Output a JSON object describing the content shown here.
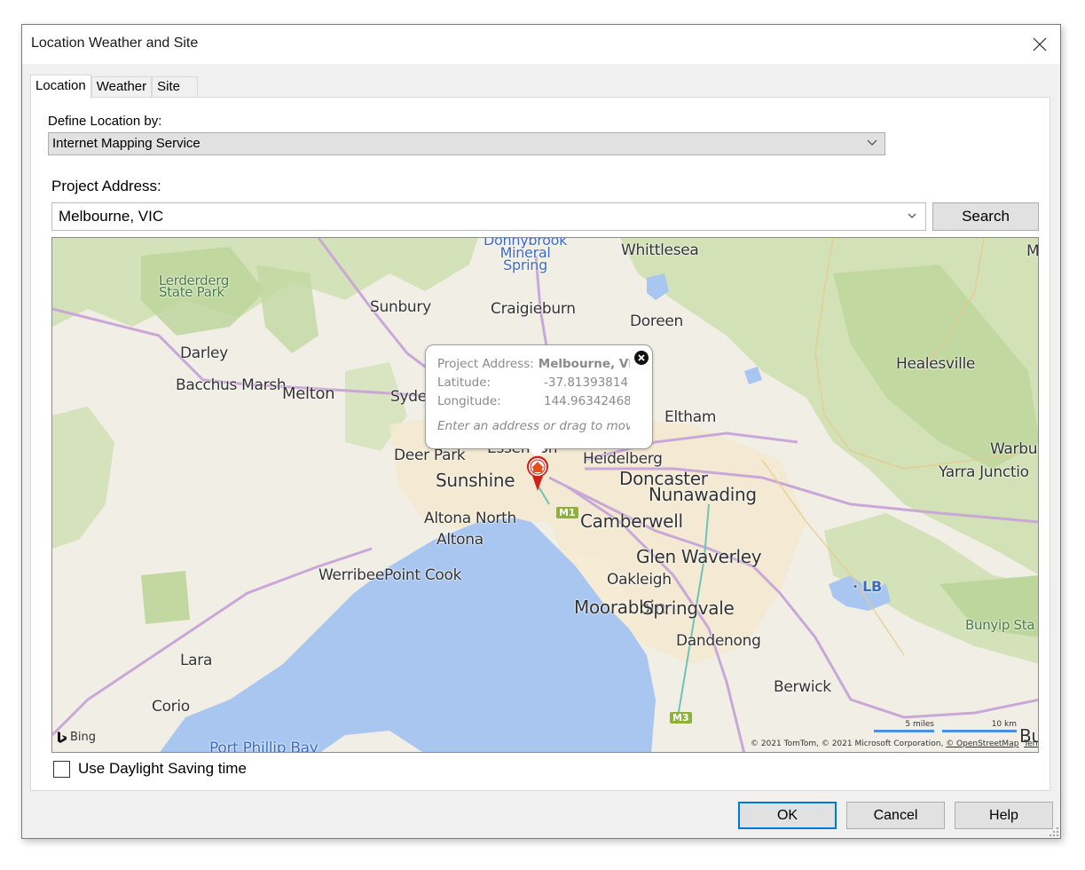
{
  "window": {
    "title": "Location Weather and Site",
    "close_icon": "close-icon"
  },
  "tabs": [
    {
      "label": "Location",
      "active": true
    },
    {
      "label": "Weather",
      "active": false
    },
    {
      "label": "Site",
      "active": false
    }
  ],
  "location": {
    "define_label": "Define Location by:",
    "define_value": "Internet Mapping Service",
    "project_address_label": "Project Address:",
    "project_address_value": "Melbourne, VIC",
    "search_label": "Search"
  },
  "map": {
    "provider": "Bing",
    "places": [
      {
        "name": "Lerderderg\nState Park",
        "type": "park"
      },
      {
        "name": "Donnybrook\nMineral\nSpring",
        "type": "water"
      },
      {
        "name": "Whittlesea",
        "type": "town"
      },
      {
        "name": "Sunbury",
        "type": "town"
      },
      {
        "name": "Craigieburn",
        "type": "town"
      },
      {
        "name": "Doreen",
        "type": "town"
      },
      {
        "name": "Darley",
        "type": "town"
      },
      {
        "name": "Healesville",
        "type": "town"
      },
      {
        "name": "Bacchus Marsh",
        "type": "town"
      },
      {
        "name": "Melton",
        "type": "town"
      },
      {
        "name": "Syde",
        "type": "town"
      },
      {
        "name": "Eltham",
        "type": "town"
      },
      {
        "name": "Deer Park",
        "type": "town"
      },
      {
        "name": "Essendon",
        "type": "town"
      },
      {
        "name": "Heidelberg",
        "type": "town"
      },
      {
        "name": "Warbu",
        "type": "town"
      },
      {
        "name": "Yarra Junctio",
        "type": "town"
      },
      {
        "name": "Sunshine",
        "type": "town"
      },
      {
        "name": "Doncaster",
        "type": "town"
      },
      {
        "name": "Nunawading",
        "type": "town"
      },
      {
        "name": "Altona North",
        "type": "town"
      },
      {
        "name": "Camberwell",
        "type": "town"
      },
      {
        "name": "Altona",
        "type": "town"
      },
      {
        "name": "Glen Waverley",
        "type": "town"
      },
      {
        "name": "Werribee",
        "type": "town"
      },
      {
        "name": "Point Cook",
        "type": "town"
      },
      {
        "name": "Oakleigh",
        "type": "town"
      },
      {
        "name": "LB",
        "type": "water"
      },
      {
        "name": "Moorabbin",
        "type": "town"
      },
      {
        "name": "Springvale",
        "type": "town"
      },
      {
        "name": "Bunyip Sta",
        "type": "park"
      },
      {
        "name": "Dandenong",
        "type": "town"
      },
      {
        "name": "Lara",
        "type": "town"
      },
      {
        "name": "Berwick",
        "type": "town"
      },
      {
        "name": "Corio",
        "type": "town"
      },
      {
        "name": "Port Phillip Bay",
        "type": "water"
      },
      {
        "name": "Bu",
        "type": "town"
      },
      {
        "name": "M",
        "type": "town"
      }
    ],
    "shields": [
      "M1",
      "M3"
    ],
    "popup": {
      "address_label": "Project Address:",
      "address_value": "Melbourne, VIC",
      "latitude_label": "Latitude:",
      "latitude_value": "-37.81393814",
      "longitude_label": "Longitude:",
      "longitude_value": "144.96342468",
      "hint": "Enter an address or drag to move the pin"
    },
    "scale": {
      "miles": "5 miles",
      "km": "10 km"
    },
    "copyright": "© 2021 TomTom, © 2021 Microsoft Corporation,",
    "osm_link": "© OpenStreetMap",
    "terms_link": "Terms"
  },
  "daylight_saving": {
    "label": "Use Daylight Saving time",
    "checked": false
  },
  "buttons": {
    "ok": "OK",
    "cancel": "Cancel",
    "help": "Help"
  },
  "colors": {
    "accent": "#0078d7",
    "water": "#a8c6ef",
    "park": "#c9dca6",
    "pin": "#d0201a"
  }
}
